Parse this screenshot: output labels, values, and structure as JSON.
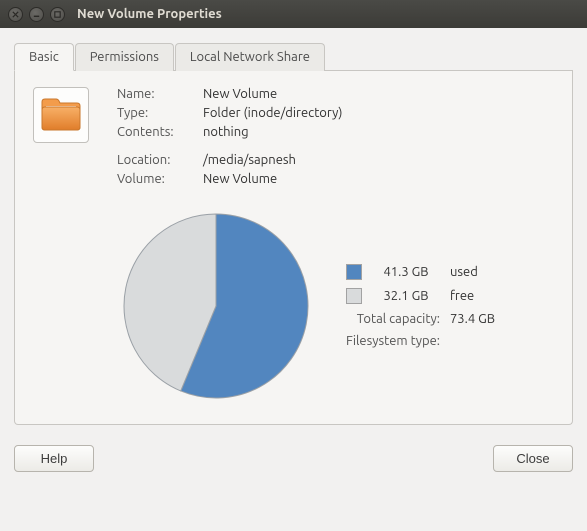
{
  "window": {
    "title": "New Volume Properties"
  },
  "tabs": {
    "basic": "Basic",
    "permissions": "Permissions",
    "localnet": "Local Network Share"
  },
  "props": {
    "name_label": "Name:",
    "name_value": "New Volume",
    "type_label": "Type:",
    "type_value": "Folder (inode/directory)",
    "contents_label": "Contents:",
    "contents_value": "nothing",
    "location_label": "Location:",
    "location_value": "/media/sapnesh",
    "volume_label": "Volume:",
    "volume_value": "New Volume"
  },
  "disk": {
    "used_value": "41.3 GB",
    "used_label": "used",
    "free_value": "32.1 GB",
    "free_label": "free",
    "total_label": "Total capacity:",
    "total_value": "73.4 GB",
    "fstype_label": "Filesystem type:",
    "fstype_value": ""
  },
  "buttons": {
    "help": "Help",
    "close": "Close"
  },
  "chart_data": {
    "type": "pie",
    "title": "",
    "series": [
      {
        "name": "used",
        "value": 41.3,
        "color": "#5286bf"
      },
      {
        "name": "free",
        "value": 32.1,
        "color": "#d9dbdc"
      }
    ],
    "total": 73.4,
    "unit": "GB"
  }
}
